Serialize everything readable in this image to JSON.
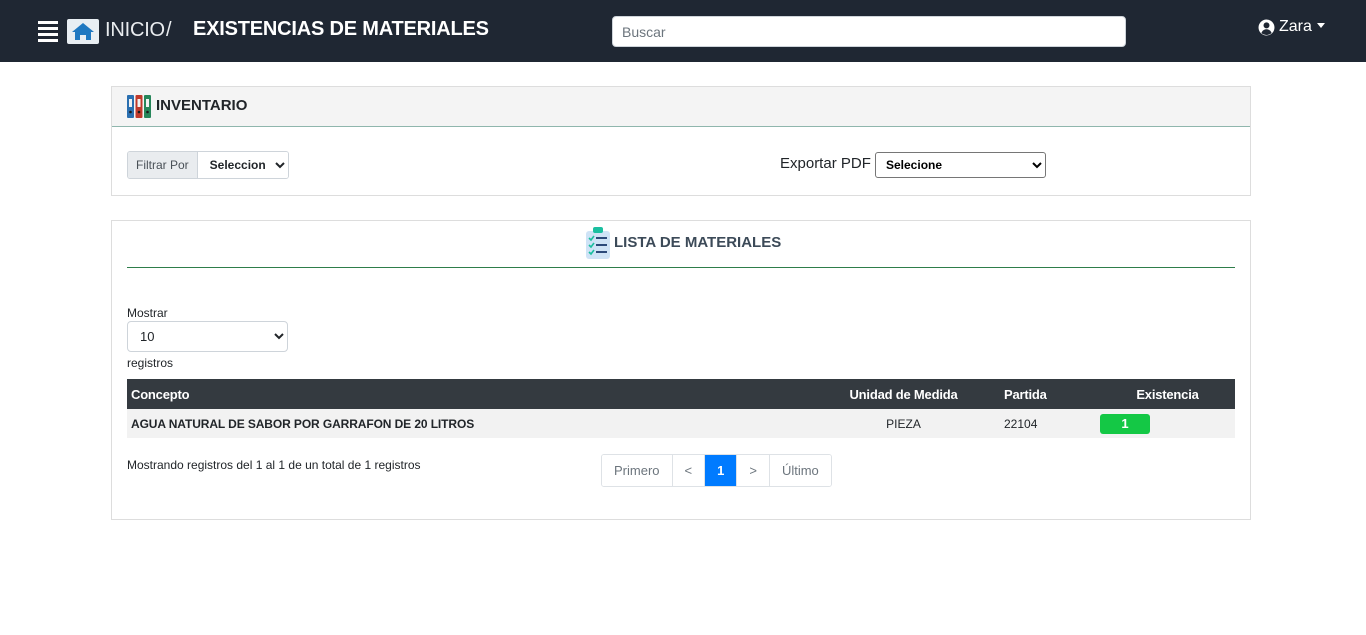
{
  "header": {
    "breadcrumb_home": "INICIO",
    "breadcrumb_sep": "/",
    "title": "EXISTENCIAS DE MATERIALES",
    "search_placeholder": "Buscar",
    "user_name": "Zara",
    "icons": {
      "menu": "menu-icon",
      "home": "home-icon",
      "user": "user-circle-icon"
    }
  },
  "inventory_panel": {
    "title": "INVENTARIO",
    "filter_label": "Filtrar Por",
    "filter_value": "Seleccion",
    "export_label": "Exportar PDF",
    "export_value": "Selecione"
  },
  "materials_panel": {
    "title": "LISTA DE MATERIALES",
    "show_label": "Mostrar",
    "page_size": "10",
    "records_label": "registros",
    "columns": [
      "Concepto",
      "Unidad de Medida",
      "Partida",
      "Existencia"
    ],
    "rows": [
      {
        "concepto": "AGUA NATURAL DE SABOR POR GARRAFON DE 20 LITROS",
        "unidad": "PIEZA",
        "partida": "22104",
        "existencia": "1"
      }
    ],
    "summary": "Mostrando registros del 1 al 1 de un total de 1 registros",
    "pagination": {
      "first": "Primero",
      "prev": "<",
      "current": "1",
      "next": ">",
      "last": "Último"
    }
  },
  "colors": {
    "navbar": "#1f2733",
    "table_header": "#343a40",
    "stock_badge": "#14c845",
    "active_page": "#007bff",
    "section_rule": "#2e7d4a"
  }
}
